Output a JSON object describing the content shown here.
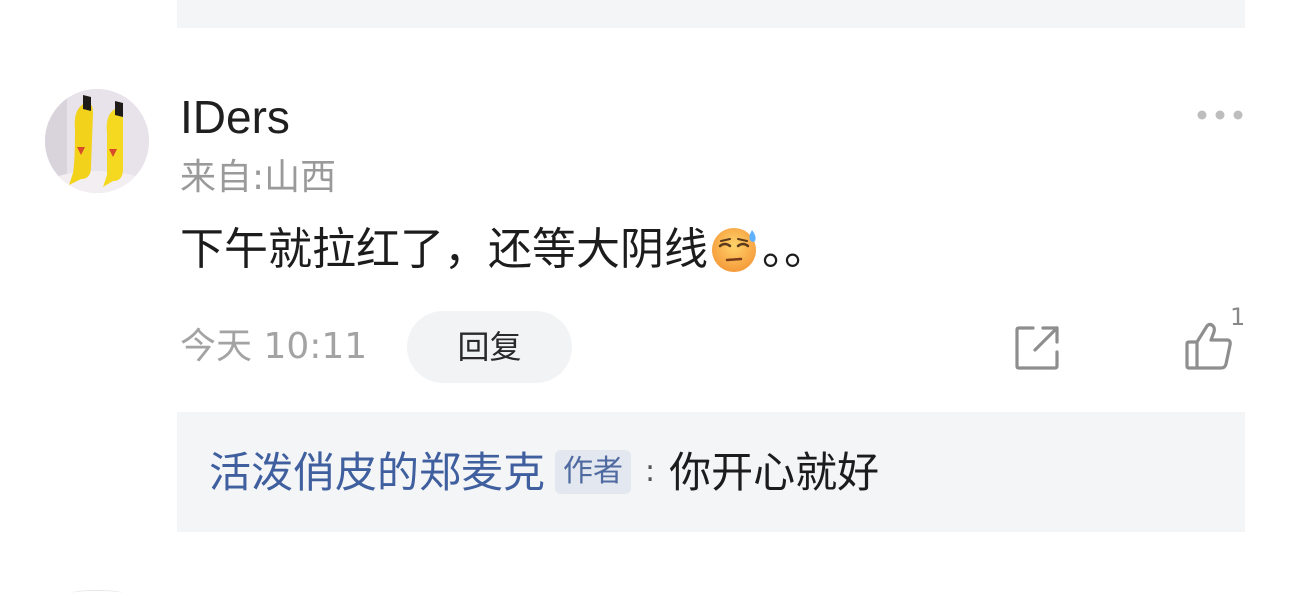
{
  "comment": {
    "username": "IDers",
    "location": "来自:山西",
    "text_before_emoji": "下午就拉红了，还等大阴线",
    "emoji": "sweat-emoji",
    "text_after_emoji": "。。",
    "time": "今天 10:11",
    "reply_label": "回复",
    "like_count": "1",
    "icons": {
      "more": "more-dots-icon",
      "share": "share-icon",
      "like": "thumbs-up-icon"
    }
  },
  "reply": {
    "author": "活泼俏皮的郑麦克",
    "badge": "作者",
    "separator": ":",
    "text": "你开心就好"
  },
  "colors": {
    "reply_author": "#3f5f9f",
    "badge_bg": "#e3e7ef",
    "panel_bg": "#f4f5f7"
  }
}
